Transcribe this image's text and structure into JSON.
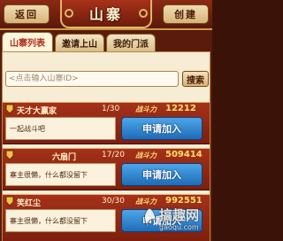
{
  "header": {
    "back_label": "返回",
    "title": "山寨",
    "create_label": "创建"
  },
  "tabs": [
    {
      "label": "山寨列表",
      "active": true
    },
    {
      "label": "邀请上山",
      "active": false
    },
    {
      "label": "我的门派",
      "active": false
    }
  ],
  "search": {
    "placeholder": "<点击输入山寨ID>",
    "button_label": "搜索"
  },
  "guilds": [
    {
      "name": "天才大赢家",
      "members": "1/30",
      "power_label": "战斗力",
      "power": "12212",
      "motto": "一起战斗吧",
      "apply_label": "申请加入"
    },
    {
      "name": "六扇门",
      "members": "17/20",
      "power_label": "战斗力",
      "power": "509414",
      "motto": "寨主很懒，什么都没留下",
      "apply_label": "申请加入"
    },
    {
      "name": "笑红尘",
      "members": "30/30",
      "power_label": "战斗力",
      "power": "992551",
      "motto": "寨主很懒，什么都没留下",
      "apply_label": "申请加入"
    }
  ],
  "watermark": {
    "text": "搞趣网",
    "url": "gaoqu.com"
  },
  "colors": {
    "header_bg": "#7a2410",
    "panel_bg": "#f7ecd4",
    "card_bg": "#921f10",
    "apply_button": "#2f86d2",
    "power_value": "#ffe06a",
    "active_tab_text": "#b0301a"
  }
}
